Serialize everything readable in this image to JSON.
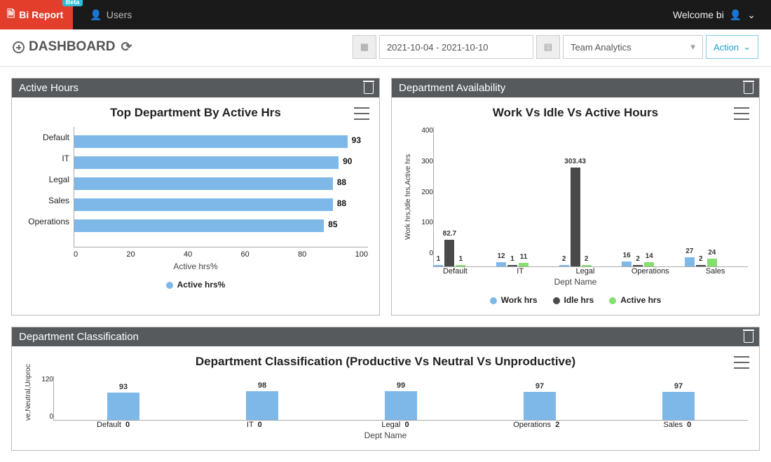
{
  "nav": {
    "brand": "Bi Report",
    "beta": "Beta",
    "users": "Users",
    "welcome": "Welcome bi"
  },
  "toolbar": {
    "title": "DASHBOARD",
    "date_range": "2021-10-04 - 2021-10-10",
    "view": "Team Analytics",
    "action": "Action"
  },
  "panels": {
    "p1_title": "Active Hours",
    "p2_title": "Department Availability",
    "p3_title": "Department Classification"
  },
  "chart_data": [
    {
      "id": "active_hours",
      "type": "bar",
      "orientation": "horizontal",
      "title": "Top Department By Active Hrs",
      "xlabel": "Active hrs%",
      "xlim": [
        0,
        100
      ],
      "xticks": [
        0,
        20,
        40,
        60,
        80,
        100
      ],
      "categories": [
        "Default",
        "IT",
        "Legal",
        "Sales",
        "Operations"
      ],
      "values": [
        93,
        90,
        88,
        88,
        85
      ],
      "legend": [
        "Active hrs%"
      ],
      "colors": {
        "Active hrs%": "#7db8e8"
      }
    },
    {
      "id": "dept_availability",
      "type": "bar",
      "orientation": "vertical",
      "title": "Work Vs Idle Vs Active Hours",
      "xlabel": "Dept Name",
      "ylabel": "Work hrs,Idle hrs,Active hrs",
      "ylim": [
        0,
        400
      ],
      "yticks": [
        0,
        100,
        200,
        300,
        400
      ],
      "categories": [
        "Default",
        "IT",
        "Legal",
        "Operations",
        "Sales"
      ],
      "series": [
        {
          "name": "Work hrs",
          "color": "#7db8e8",
          "values": [
            1,
            12,
            2,
            16,
            27
          ]
        },
        {
          "name": "Idle hrs",
          "color": "#4a4a4a",
          "values": [
            82.7,
            1,
            303.43,
            2,
            2
          ]
        },
        {
          "name": "Active hrs",
          "color": "#83e06b",
          "values": [
            1,
            11,
            2,
            14,
            24
          ]
        }
      ]
    },
    {
      "id": "dept_classification",
      "type": "bar",
      "orientation": "vertical",
      "title": "Department Classification (Productive Vs Neutral Vs Unproductive)",
      "xlabel": "Dept Name",
      "ylabel": "ve,Neutral,Unproc",
      "ylim": [
        0,
        120
      ],
      "yticks": [
        0,
        120
      ],
      "categories": [
        "Default",
        "IT",
        "Legal",
        "Operations",
        "Sales"
      ],
      "series": [
        {
          "name": "Productive",
          "color": "#7db8e8",
          "values": [
            93,
            98,
            99,
            97,
            97
          ]
        },
        {
          "name": "Neutral",
          "color": "#4a4a4a",
          "values": [
            0,
            0,
            0,
            2,
            0
          ]
        },
        {
          "name": "Unproductive",
          "color": "#83e06b",
          "values": [
            0,
            0,
            0,
            0,
            0
          ]
        }
      ]
    }
  ]
}
